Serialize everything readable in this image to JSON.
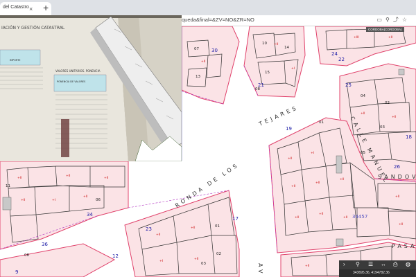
{
  "browser": {
    "tab_title": "del Catastro",
    "tab_close": "×",
    "new_tab": "+",
    "url": "queda&final=&ZV=NO&ZR=NO"
  },
  "map": {
    "town_tag": "CORDOBA(CORDOBA)",
    "streets": {
      "ronda": "RONDA DE LOS",
      "tejares": "TEJARES",
      "manuel": "CALLE MANUEL",
      "sandoval": "SANDOVAL",
      "pasaje": "PASAJE",
      "av": "AV"
    },
    "house_numbers": [
      "19",
      "34",
      "23",
      "30",
      "24",
      "22",
      "18",
      "17",
      "21",
      "36",
      "12",
      "9",
      "25",
      "26"
    ],
    "parcel_numbers": [
      "10",
      "14",
      "15",
      "08",
      "07",
      "13",
      "04",
      "01",
      "11",
      "06",
      "02",
      "03",
      "05",
      "24",
      "21",
      "20"
    ],
    "block_id": "34457"
  },
  "photo": {
    "document_header": "IACIÓN Y GESTIÓN CATASTRAL",
    "table_title": "VALORES UNITARIOS. PONENCIA",
    "table_col1": "IMPORTE",
    "table_col2": "PONENCIA DE VALORES"
  },
  "toolbar": {
    "coords": "343695.36, 4194782.36"
  }
}
